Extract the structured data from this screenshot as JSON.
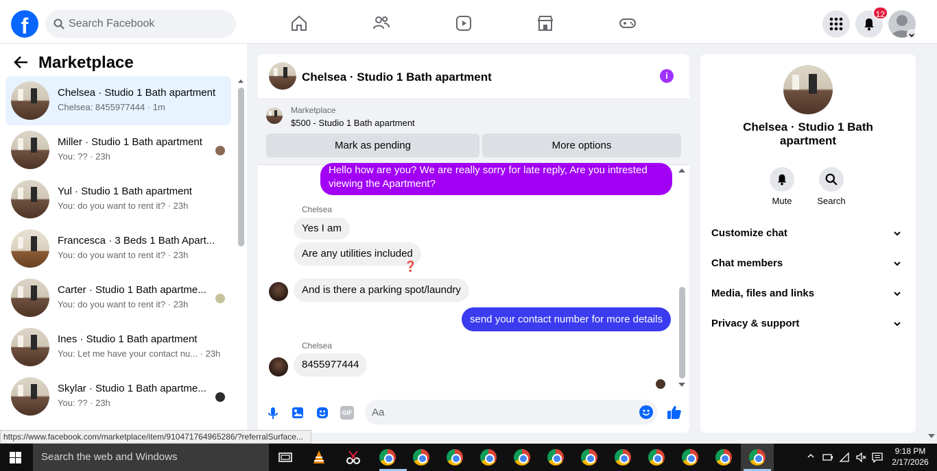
{
  "topbar": {
    "search_placeholder": "Search Facebook",
    "notification_count": "12"
  },
  "left": {
    "title": "Marketplace",
    "conversations": [
      {
        "name": "Chelsea · Studio 1 Bath apartment",
        "sub": "Chelsea: 8455977444 · 1m"
      },
      {
        "name": "Miller · Studio 1 Bath apartment",
        "sub": "You: ?? · 23h"
      },
      {
        "name": "Yul · Studio 1 Bath apartment",
        "sub": "You: do you want to rent it? · 23h"
      },
      {
        "name": "Francesca · 3 Beds 1 Bath Apart...",
        "sub": "You: do you want to rent it? · 23h"
      },
      {
        "name": "Carter · Studio 1 Bath apartme...",
        "sub": "You: do you want to rent it? · 23h"
      },
      {
        "name": "Ines · Studio 1 Bath apartment",
        "sub": "You: Let me have your contact nu...  · 23h"
      },
      {
        "name": "Skylar · Studio 1 Bath apartme...",
        "sub": "You: ?? · 23h"
      }
    ]
  },
  "chat": {
    "title": "Chelsea · Studio 1 Bath apartment",
    "marketplace_label": "Marketplace",
    "listing": "$500 - Studio 1 Bath apartment",
    "mark_pending": "Mark as pending",
    "more_options": "More options",
    "messages": {
      "m1": "Hello how are you? We are really sorry for late reply,  Are you intrested viewing the Apartment?",
      "sender1": "Chelsea",
      "m2": "Yes I am",
      "m3": "Are any utilities included",
      "m3_reaction": "❓",
      "m4": "And is there a parking spot/laundry",
      "m5": "send your contact number for more details",
      "sender2": "Chelsea",
      "m6": "8455977444"
    },
    "composer_placeholder": "Aa",
    "gif_label": "GIF"
  },
  "right": {
    "title": "Chelsea · Studio 1 Bath apartment",
    "mute": "Mute",
    "search": "Search",
    "sections": [
      "Customize chat",
      "Chat members",
      "Media, files and links",
      "Privacy & support"
    ]
  },
  "status_url": "https://www.facebook.com/marketplace/item/910471764965286/?referralSurface...",
  "taskbar": {
    "search": "Search the web and Windows",
    "time": "9:18 PM",
    "date": "2/17/2026"
  },
  "colors": {
    "brand": "#0866ff",
    "purple_bubble": "#a100f5",
    "blue_bubble": "#3b3bf0",
    "badge": "#e41e3f"
  }
}
